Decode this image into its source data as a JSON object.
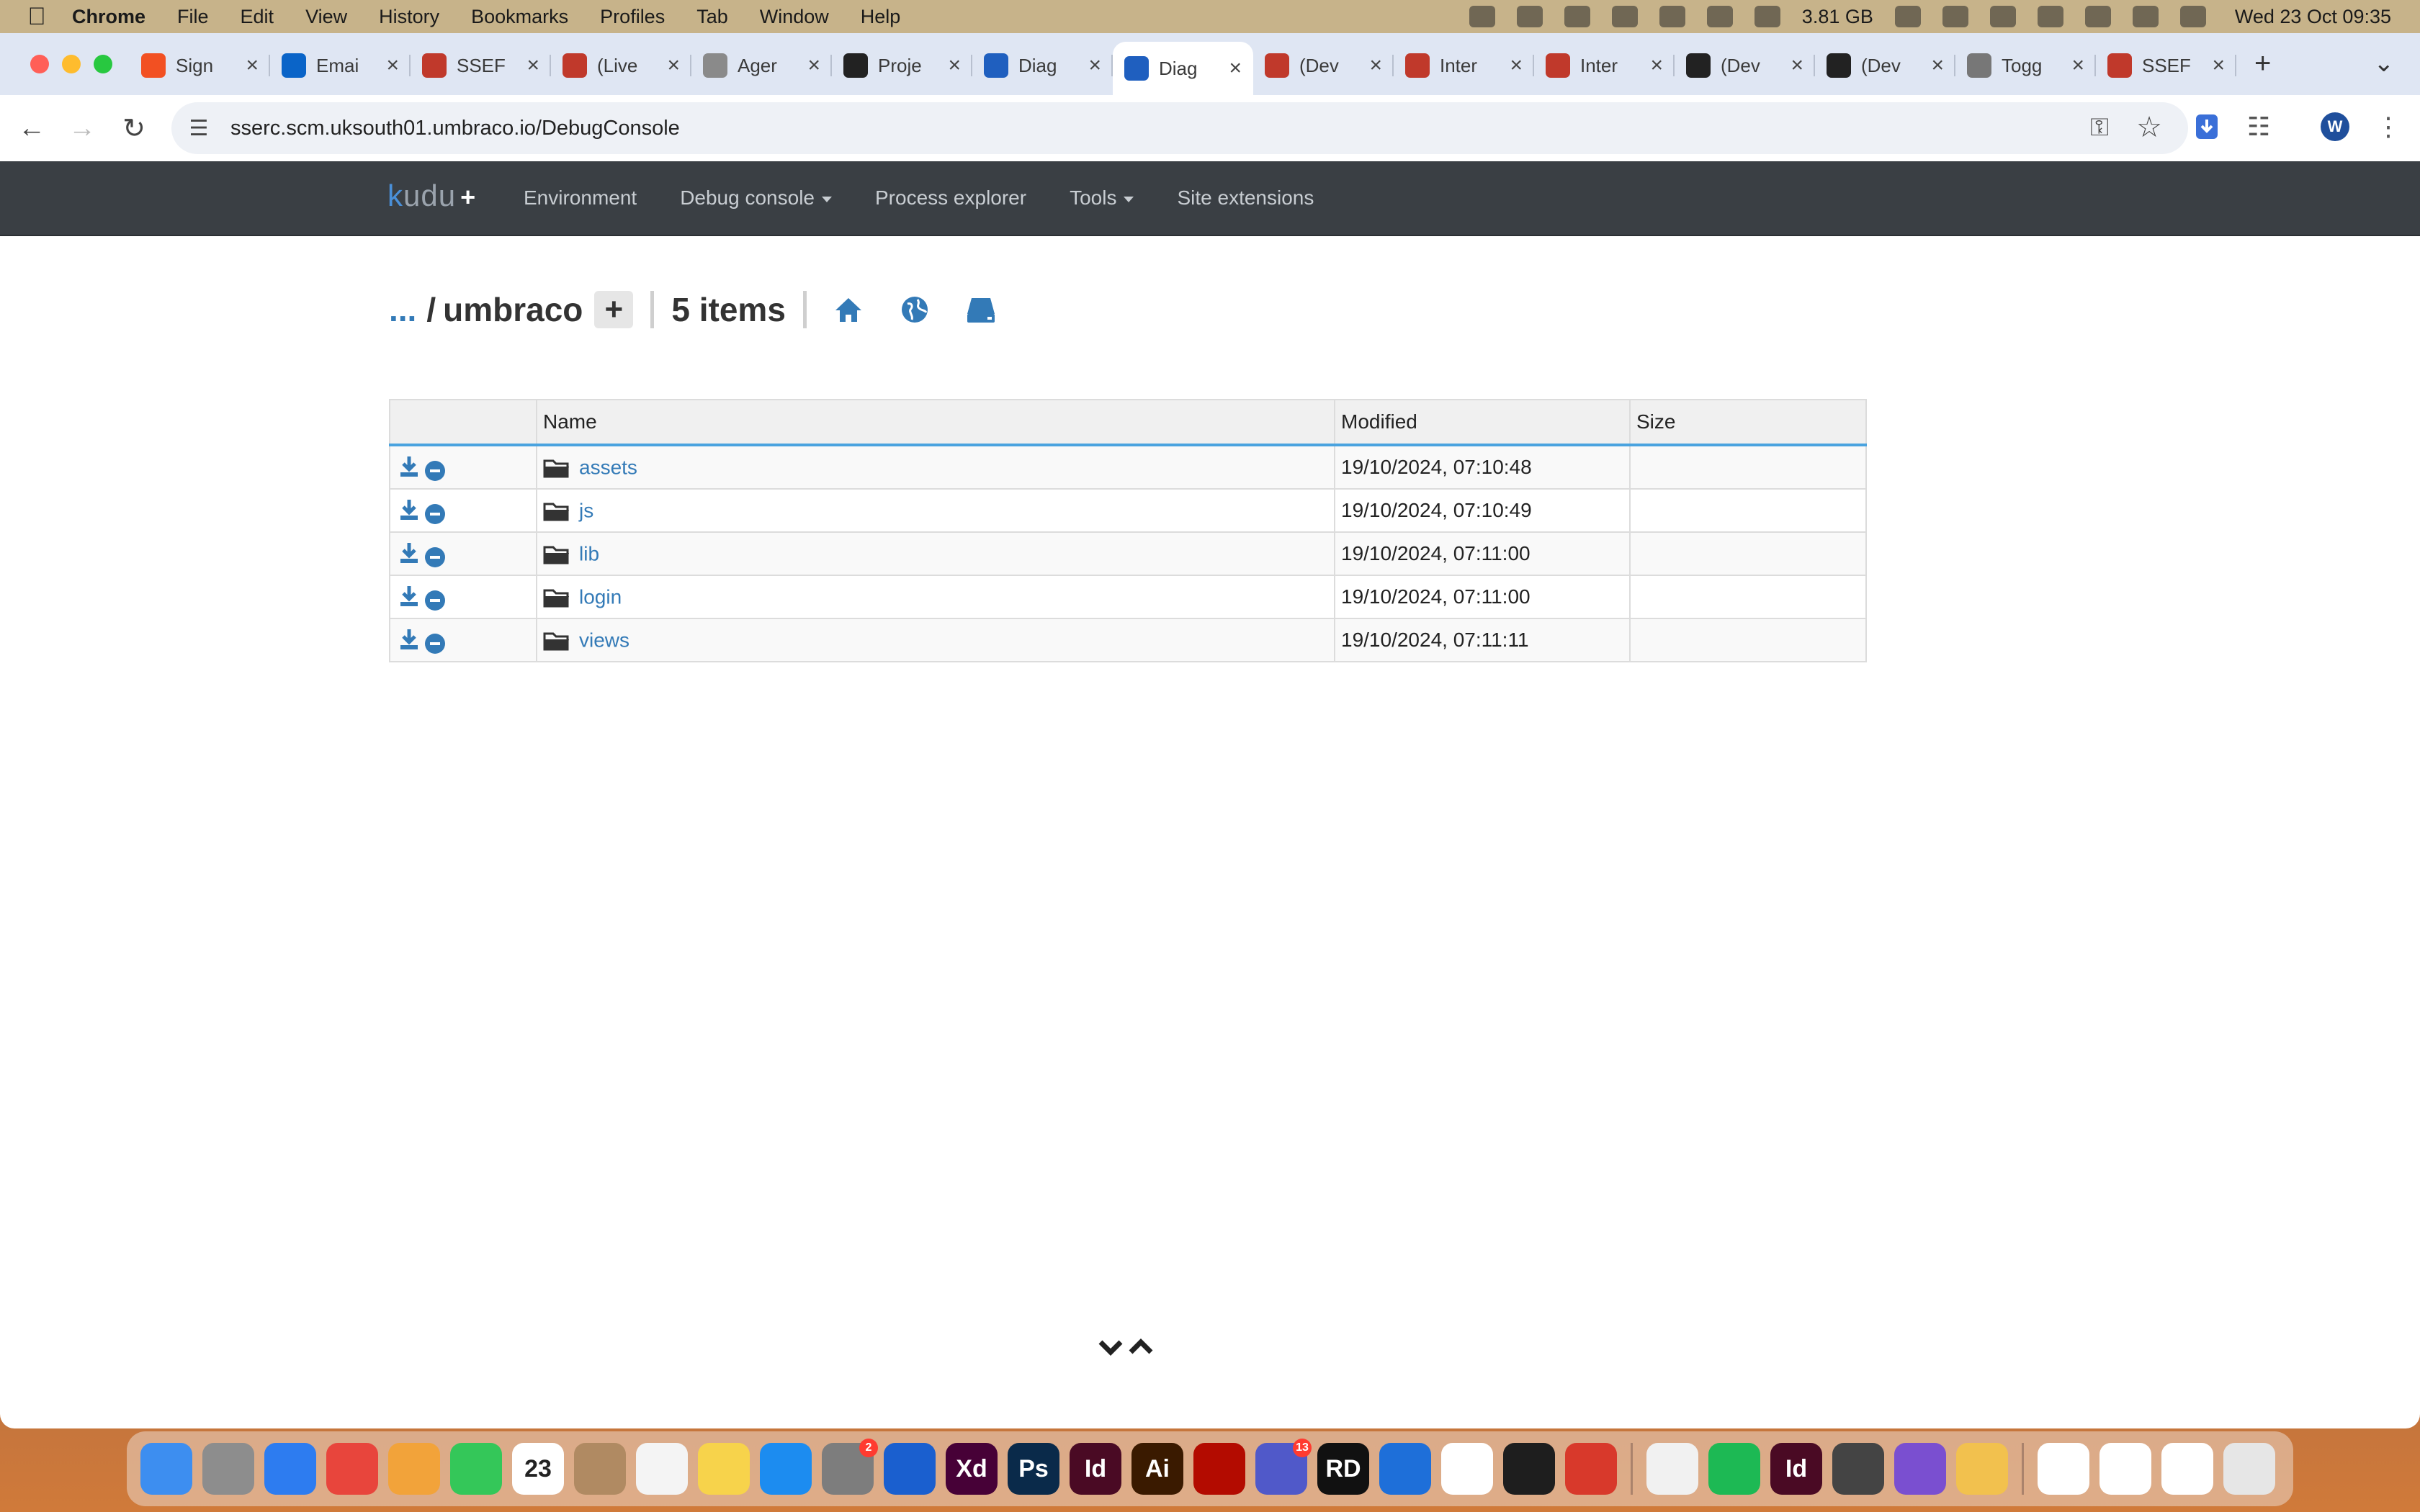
{
  "menubar": {
    "app": "Chrome",
    "items": [
      "File",
      "Edit",
      "View",
      "History",
      "Bookmarks",
      "Profiles",
      "Tab",
      "Window",
      "Help"
    ],
    "memory": "3.81 GB",
    "clock": "Wed 23 Oct  09:35"
  },
  "tabs": [
    {
      "label": "Sign",
      "color": "#f25022"
    },
    {
      "label": "Emai",
      "color": "#0a64c8"
    },
    {
      "label": "SSEF",
      "color": "#c0392b"
    },
    {
      "label": "(Live",
      "color": "#c0392b"
    },
    {
      "label": "Ager",
      "color": "#8a8a8a"
    },
    {
      "label": "Proje",
      "color": "#222222"
    },
    {
      "label": "Diag",
      "color": "#1f5fbf"
    },
    {
      "label": "Diag",
      "color": "#1f5fbf",
      "active": true
    },
    {
      "label": "(Dev",
      "color": "#c0392b"
    },
    {
      "label": "Inter",
      "color": "#c0392b"
    },
    {
      "label": "Inter",
      "color": "#c0392b"
    },
    {
      "label": "(Dev",
      "color": "#222222"
    },
    {
      "label": "(Dev",
      "color": "#222222"
    },
    {
      "label": "Togg",
      "color": "#777777"
    },
    {
      "label": "SSEF",
      "color": "#c0392b"
    }
  ],
  "browser": {
    "url": "sserc.scm.uksouth01.umbraco.io/DebugConsole",
    "profile_initial": "W"
  },
  "kudu": {
    "brand_k": "k",
    "brand_rest": "udu",
    "brand_plus": "+",
    "nav": {
      "environment": "Environment",
      "debug_console": "Debug console",
      "process_explorer": "Process explorer",
      "tools": "Tools",
      "site_extensions": "Site extensions"
    },
    "breadcrumb": {
      "dots": "...",
      "slash": "/",
      "folder": "umbraco",
      "add": "+",
      "count": "5 items"
    },
    "table": {
      "headers": {
        "name": "Name",
        "modified": "Modified",
        "size": "Size"
      },
      "rows": [
        {
          "name": "assets",
          "modified": "19/10/2024, 07:10:48",
          "size": ""
        },
        {
          "name": "js",
          "modified": "19/10/2024, 07:10:49",
          "size": ""
        },
        {
          "name": "lib",
          "modified": "19/10/2024, 07:11:00",
          "size": ""
        },
        {
          "name": "login",
          "modified": "19/10/2024, 07:11:00",
          "size": ""
        },
        {
          "name": "views",
          "modified": "19/10/2024, 07:11:11",
          "size": ""
        }
      ]
    }
  },
  "dock": {
    "apps": [
      {
        "name": "finder",
        "color": "#3d8ef0"
      },
      {
        "name": "launchpad",
        "color": "#8d8d8d"
      },
      {
        "name": "safari",
        "color": "#2d7cf0"
      },
      {
        "name": "chrome",
        "color": "#e8453c"
      },
      {
        "name": "photos",
        "color": "#f2a33a"
      },
      {
        "name": "facetime",
        "color": "#34c759"
      },
      {
        "name": "calendar",
        "color": "#ffffff",
        "text": "23"
      },
      {
        "name": "contacts",
        "color": "#b08a62"
      },
      {
        "name": "reminders",
        "color": "#f4f4f4"
      },
      {
        "name": "notes",
        "color": "#f7d34b"
      },
      {
        "name": "app-store",
        "color": "#1c8cf0"
      },
      {
        "name": "system-settings",
        "color": "#7d7d7d",
        "badge": "2"
      },
      {
        "name": "1password",
        "color": "#1a5fcf"
      },
      {
        "name": "adobe-xd",
        "color": "#470137",
        "text": "Xd"
      },
      {
        "name": "photoshop",
        "color": "#0a2a4a",
        "text": "Ps"
      },
      {
        "name": "indesign",
        "color": "#4a0a24",
        "text": "Id"
      },
      {
        "name": "illustrator",
        "color": "#3a1a00",
        "text": "Ai"
      },
      {
        "name": "acrobat",
        "color": "#b30b00"
      },
      {
        "name": "teams",
        "color": "#5059c9",
        "badge": "13"
      },
      {
        "name": "rider",
        "color": "#111111",
        "text": "RD"
      },
      {
        "name": "maps-pin",
        "color": "#1e6fd9"
      },
      {
        "name": "diagram-app",
        "color": "#ffffff"
      },
      {
        "name": "figma",
        "color": "#1e1e1e"
      },
      {
        "name": "remote-desktop",
        "color": "#d8392b"
      },
      {
        "name": "textedit",
        "color": "#f1f1f1"
      },
      {
        "name": "spotify",
        "color": "#1db954"
      },
      {
        "name": "indesign-2",
        "color": "#4a0a24",
        "text": "Id"
      },
      {
        "name": "app-grid",
        "color": "#444444"
      },
      {
        "name": "visual-studio",
        "color": "#7a4fd0"
      },
      {
        "name": "folder",
        "color": "#f2c14e"
      },
      {
        "name": "numbers",
        "color": "#ffffff"
      },
      {
        "name": "preview",
        "color": "#ffffff"
      },
      {
        "name": "downloads-stack",
        "color": "#ffffff"
      },
      {
        "name": "trash",
        "color": "#e6e6e6"
      }
    ]
  }
}
